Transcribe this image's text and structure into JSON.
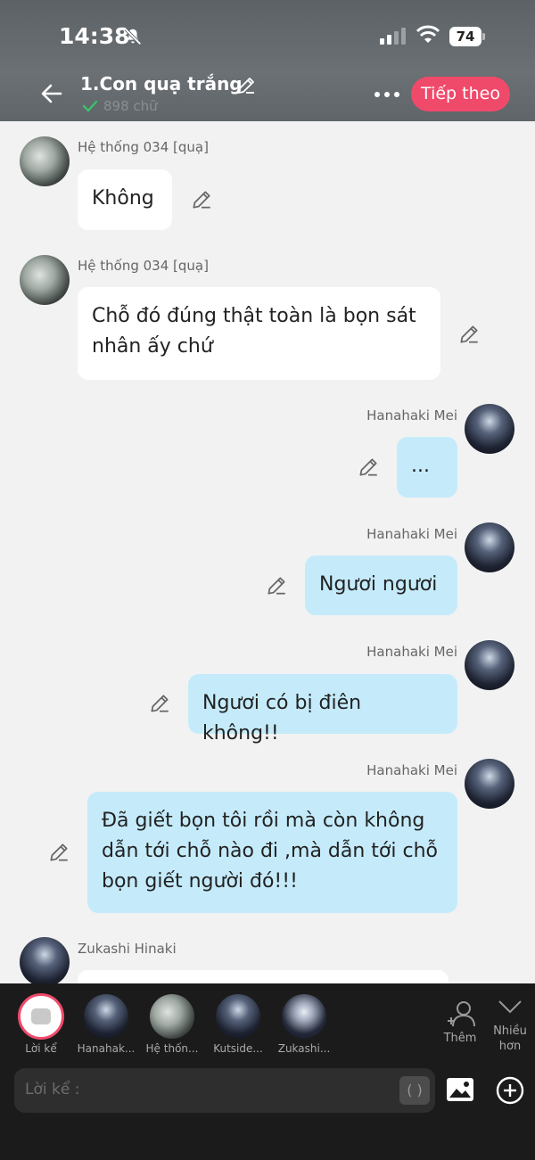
{
  "status": {
    "time": "14:38",
    "battery": "74"
  },
  "header": {
    "title": "1.Con quạ trắng",
    "wordcount": "898 chữ",
    "next_label": "Tiếp theo"
  },
  "messages": [
    {
      "sender": "Hệ thống 034 [quạ]",
      "text": "Không"
    },
    {
      "sender": "Hệ thống 034 [quạ]",
      "text": "Chỗ đó đúng thật toàn là bọn sát\nnhân ấy chứ"
    },
    {
      "sender": "Hanahaki Mei",
      "text": "..."
    },
    {
      "sender": "Hanahaki Mei",
      "text": "Ngươi ngươi"
    },
    {
      "sender": "Hanahaki Mei",
      "text": "Ngươi có bị điên không!!"
    },
    {
      "sender": "Hanahaki Mei",
      "text": "Đã giết bọn tôi rồi mà còn không\ndẫn tới chỗ nào đi ,mà dẫn tới chỗ\nbọn giết người đó!!!"
    },
    {
      "sender": "Zukashi Hinaki",
      "text": ""
    }
  ],
  "characters": [
    {
      "name": "Lời kể"
    },
    {
      "name": "Hanahak..."
    },
    {
      "name": "Hệ thốn..."
    },
    {
      "name": "Kutside..."
    },
    {
      "name": "Zukashi..."
    }
  ],
  "toolbar": {
    "add_label": "Thêm",
    "more_label": "Nhiều\nhơn"
  },
  "composer": {
    "placeholder": "Lời kể :",
    "paren": "( )"
  },
  "icons": [
    "back-arrow-icon",
    "edit-pencil-icon",
    "check-icon",
    "more-dots-icon",
    "add-person-icon",
    "chevron-down-icon",
    "image-icon",
    "plus-circle-icon",
    "bell-off-icon",
    "signal-icon",
    "wifi-icon"
  ],
  "colors": {
    "accent": "#f04a6b",
    "bubble_right": "#c5ebfb",
    "bubble_left": "#ffffff"
  }
}
